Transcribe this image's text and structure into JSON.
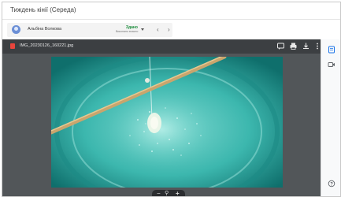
{
  "window": {
    "title": "Тиждень кінії (Середа)"
  },
  "email": {
    "sender": "Альбіна Волкова",
    "status": "Здано",
    "sub_status": "Виконано вчасно",
    "nav_prev": "‹",
    "nav_next": "›"
  },
  "viewer": {
    "file_name": "IMG_20230126_160221.jpg",
    "toolbar_icons": [
      "comment-icon",
      "print-icon",
      "download-icon",
      "more-icon"
    ],
    "zoom": {
      "minus": "−",
      "zoom_icon": "⚲",
      "plus": "+"
    }
  },
  "side_panel": {
    "icons": [
      "details-icon",
      "meet-icon",
      "help-icon"
    ]
  },
  "colors": {
    "status_green": "#1e8e3e",
    "viewer_bg": "#525659",
    "file_icon_red": "#e8453c",
    "accent_blue": "#1a73e8"
  }
}
